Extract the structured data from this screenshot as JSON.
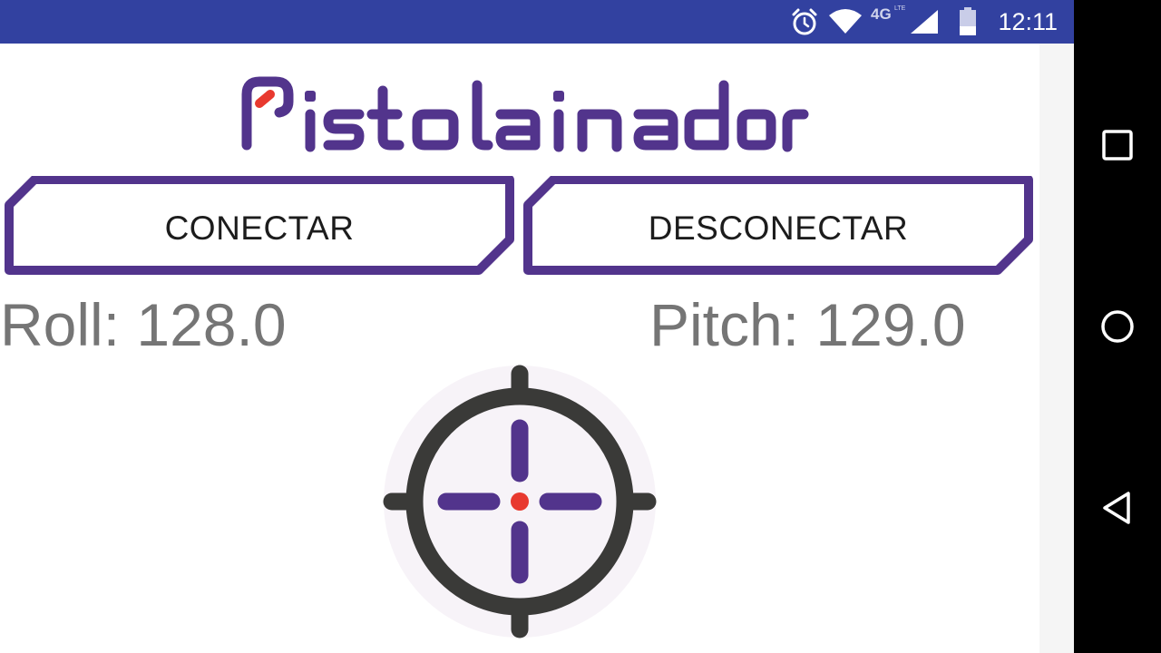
{
  "status_bar": {
    "time": "12:11",
    "network": "4G",
    "network_sub": "LTE",
    "icons": [
      "alarm-icon",
      "wifi-icon",
      "cell-signal-icon",
      "battery-icon"
    ],
    "background": "#3241a0"
  },
  "logo": {
    "text": "Pistolainador",
    "color": "#52348c",
    "accent": "#e8392f"
  },
  "buttons": {
    "connect_label": "CONECTAR",
    "disconnect_label": "DESCONECTAR",
    "border_color": "#52348c"
  },
  "readouts": {
    "roll": "Roll: 128.0",
    "pitch": "Pitch: 129.0"
  },
  "crosshair": {
    "icon": "crosshair-icon",
    "ring_color": "#3a3a38",
    "cross_color": "#52348c",
    "center_color": "#e8392f",
    "bg_color": "#f7f3f8"
  },
  "nav_bar": {
    "icons": [
      "recents-square-icon",
      "home-circle-icon",
      "back-triangle-icon"
    ]
  }
}
